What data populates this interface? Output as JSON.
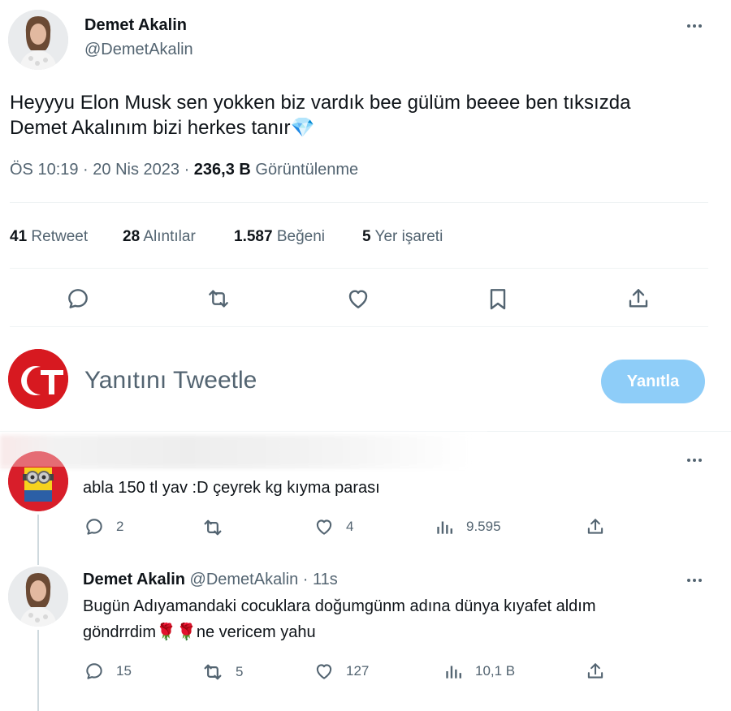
{
  "tweet": {
    "author_name": "Demet Akalin",
    "author_handle": "@DemetAkalin",
    "text_line1": "Heyyyu Elon Musk sen yokken biz vardık bee gülüm beeee ben tıksızda",
    "text_line2": "Demet Akalınım bizi herkes tanır💎",
    "time": "ÖS 10:19 · 20 Nis 2023 · ",
    "views_count": "236,3 B",
    "views_label": "Görüntülenme"
  },
  "stats": {
    "retweets_count": "41",
    "retweets_label": "Retweet",
    "quotes_count": "28",
    "quotes_label": "Alıntılar",
    "likes_count": "1.587",
    "likes_label": "Beğeni",
    "bookmarks_count": "5",
    "bookmarks_label": "Yer işareti"
  },
  "compose": {
    "placeholder": "Yanıtını Tweetle",
    "reply_button": "Yanıtla",
    "avatar_text": "cT"
  },
  "replies": [
    {
      "text": "abla 150 tl yav :D çeyrek kg kıyma parası",
      "reply_count": "2",
      "retweet_count": "",
      "like_count": "4",
      "views_count": "9.595"
    },
    {
      "author_name": "Demet Akalin",
      "author_handle": "@DemetAkalin",
      "time": "· 11s",
      "text_line1": "Bugün Adıyamandaki cocuklara doğumgünm adına dünya kıyafet aldım",
      "text_line2": "göndrrdim🌹🌹ne vericem yahu",
      "reply_count": "15",
      "retweet_count": "5",
      "like_count": "127",
      "views_count": "10,1 B"
    }
  ],
  "colors": {
    "accent": "#1d9bf0",
    "reply_button_disabled": "#8ecdf8",
    "text": "#0f1419",
    "muted": "#536471",
    "logo_red": "#d71920"
  }
}
